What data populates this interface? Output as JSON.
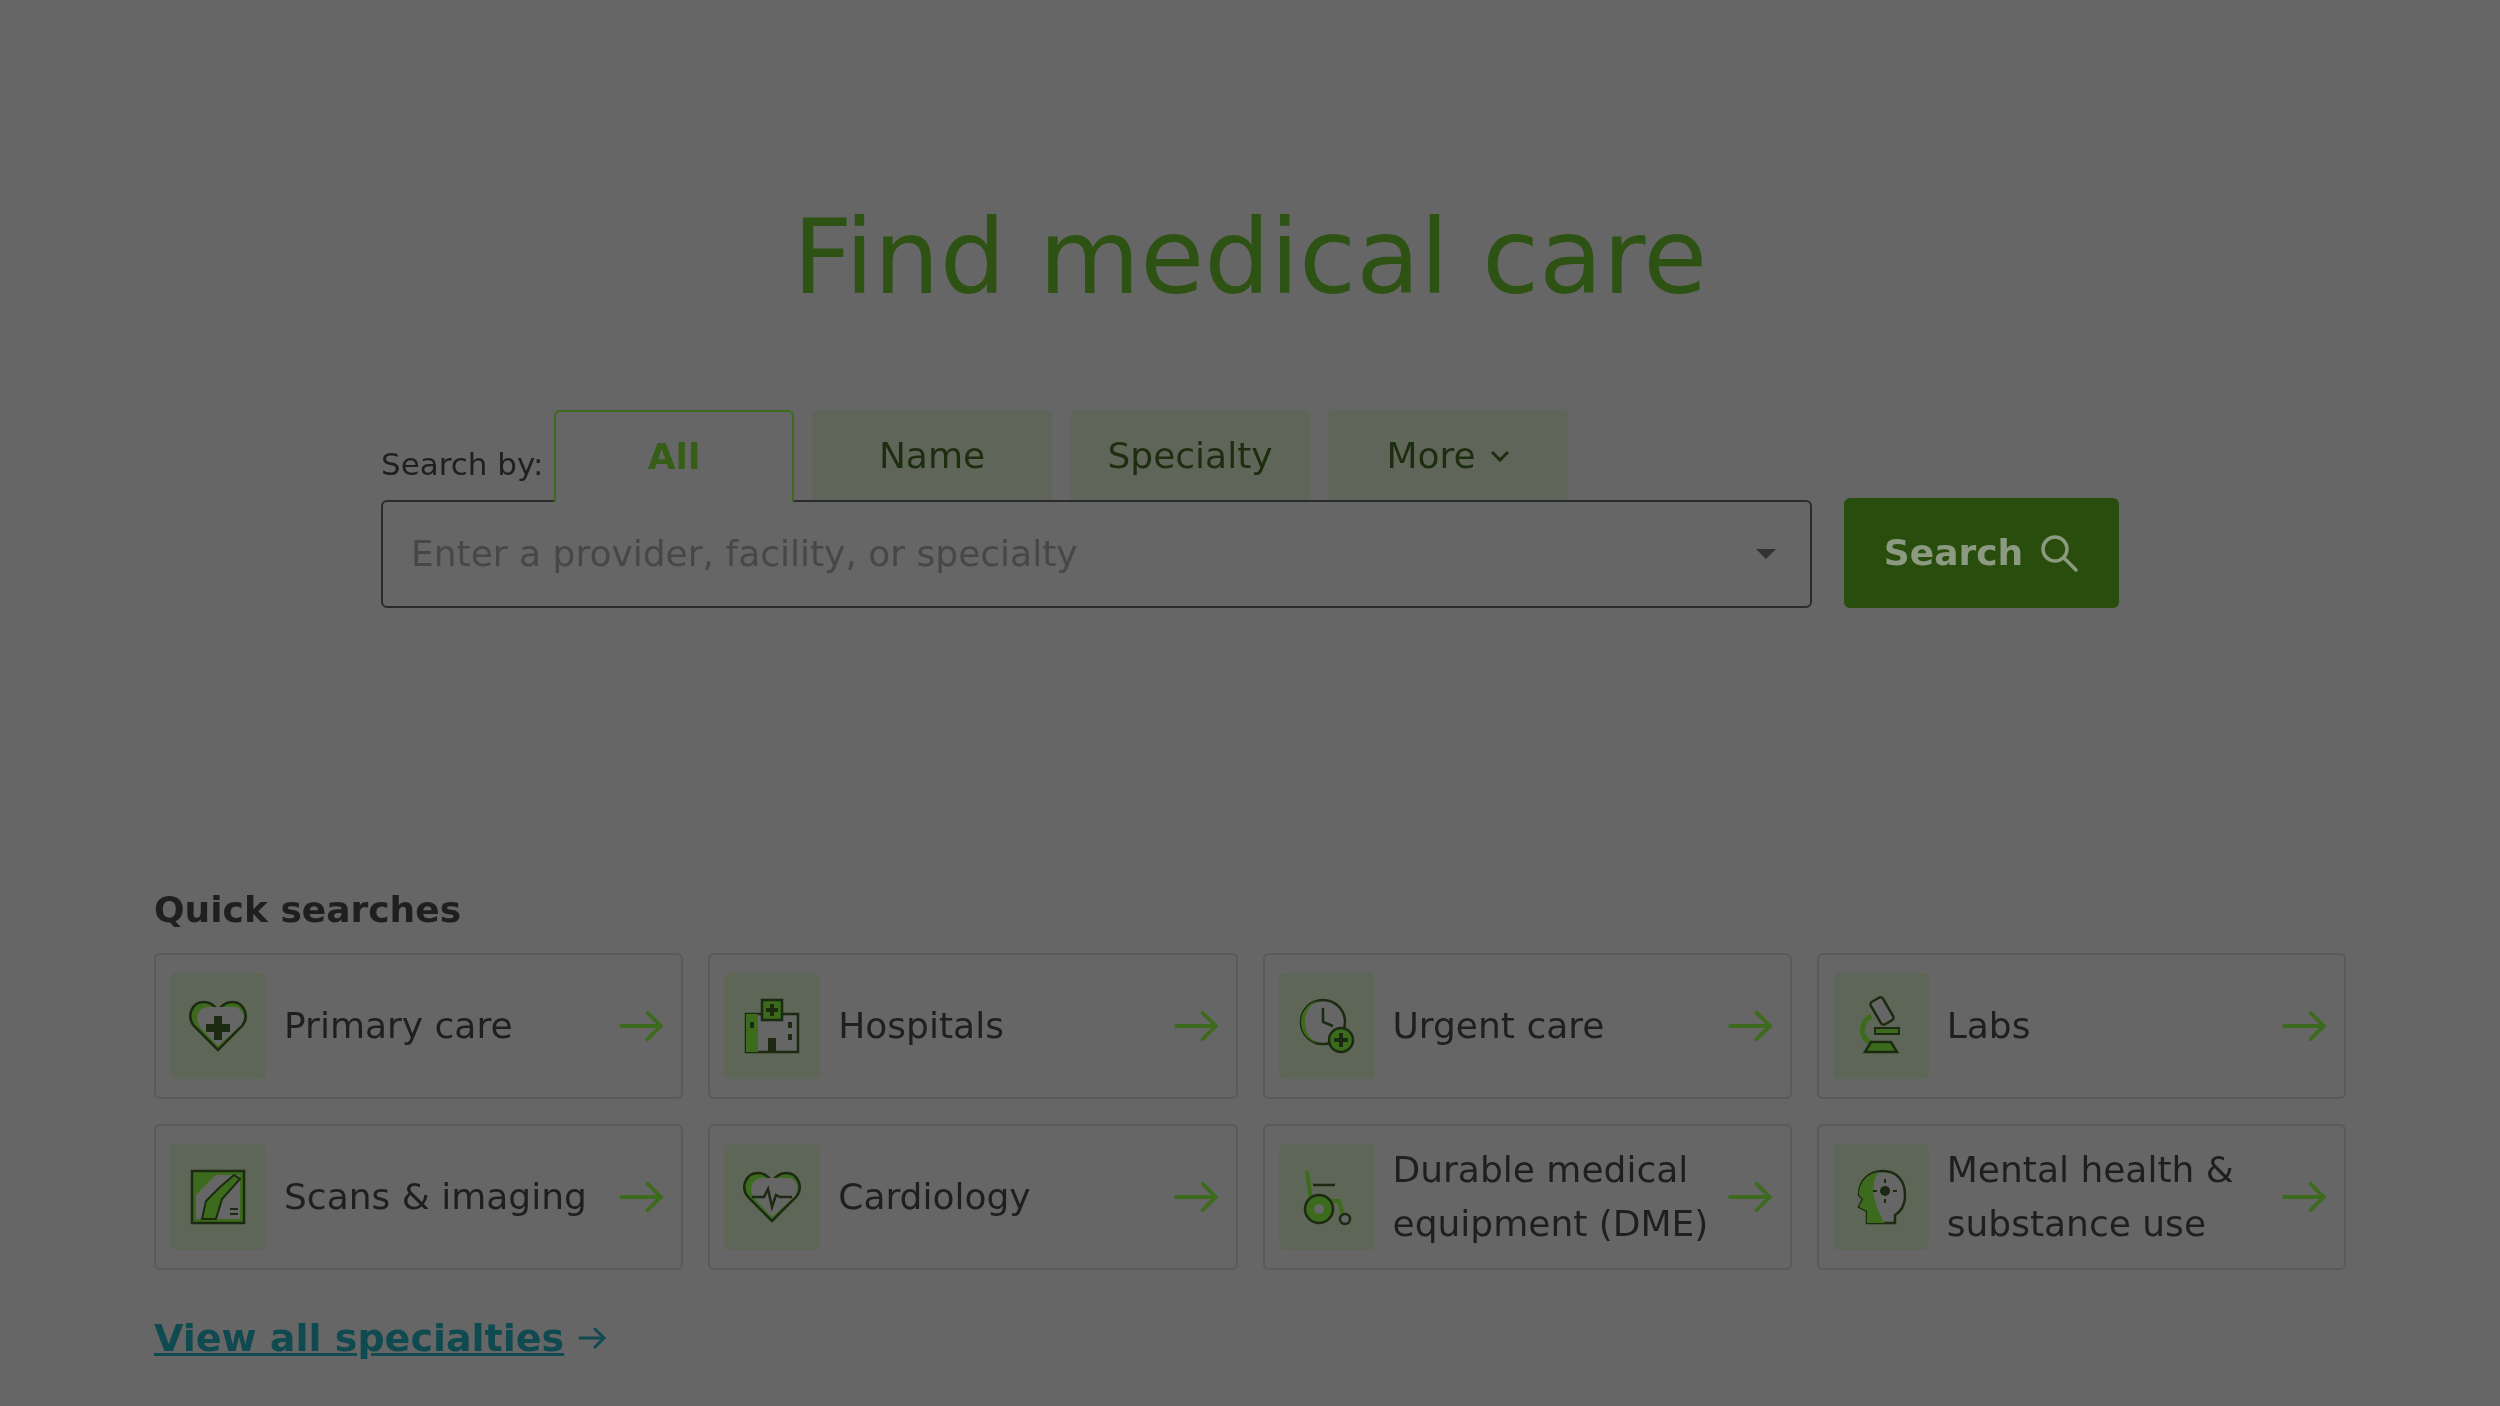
{
  "title": "Find medical care",
  "search": {
    "label": "Search by:",
    "tabs": [
      {
        "label": "All",
        "selected": true,
        "kind": "tab"
      },
      {
        "label": "Name",
        "selected": false,
        "kind": "tab"
      },
      {
        "label": "Specialty",
        "selected": false,
        "kind": "tab"
      },
      {
        "label": "More",
        "selected": false,
        "kind": "menu"
      }
    ],
    "placeholder": "Enter a provider, facility, or specialty",
    "button": "Search"
  },
  "quick_searches": {
    "heading": "Quick searches",
    "items": [
      {
        "label": "Primary care"
      },
      {
        "label": "Hospitals"
      },
      {
        "label": "Urgent care"
      },
      {
        "label": "Labs"
      },
      {
        "label": "Scans & imaging"
      },
      {
        "label": "Cardiology"
      },
      {
        "label": "Durable medical equipment (DME)"
      },
      {
        "label": "Mental health & substance use"
      }
    ],
    "view_all": "View all specialties"
  }
}
